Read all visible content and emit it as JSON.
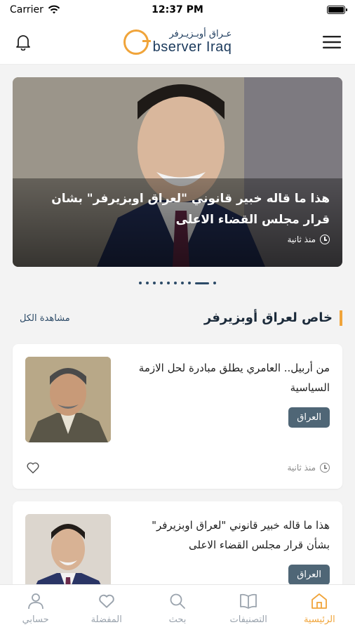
{
  "status_bar": {
    "carrier": "Carrier",
    "time": "12:37 PM"
  },
  "header": {
    "logo_ar": "عـراق أوبـزيـرفر",
    "logo_en": "bserver Iraq"
  },
  "hero": {
    "title": "هذا ما قاله خبير قانوني \"لعراق اوبزيرفر\" بشان قرار مجلس القضاء الاعلى",
    "time": "منذ ثانية",
    "dot_count": 10,
    "active_dot": 8
  },
  "section": {
    "title": "خاص لعراق أوبزيرفر",
    "see_all": "مشاهدة الكل"
  },
  "articles": [
    {
      "title": "من أربيل.. العامري يطلق مبادرة لحل الازمة السياسية",
      "tag": "العراق",
      "time": "منذ ثانية"
    },
    {
      "title": "هذا ما قاله خبير قانوني \"لعراق اوبزيرفر\" بشأن قرار مجلس القضاء الاعلى",
      "tag": "العراق"
    }
  ],
  "nav": [
    {
      "label": "حسابي",
      "icon": "user-icon"
    },
    {
      "label": "المفضلة",
      "icon": "heart-icon"
    },
    {
      "label": "بحث",
      "icon": "search-icon"
    },
    {
      "label": "التصنيفات",
      "icon": "book-icon"
    },
    {
      "label": "الرئيسية",
      "icon": "home-icon",
      "active": true
    }
  ],
  "colors": {
    "accent": "#f0a43a",
    "navy": "#1b3a5c",
    "tag_bg": "#4f6676"
  }
}
